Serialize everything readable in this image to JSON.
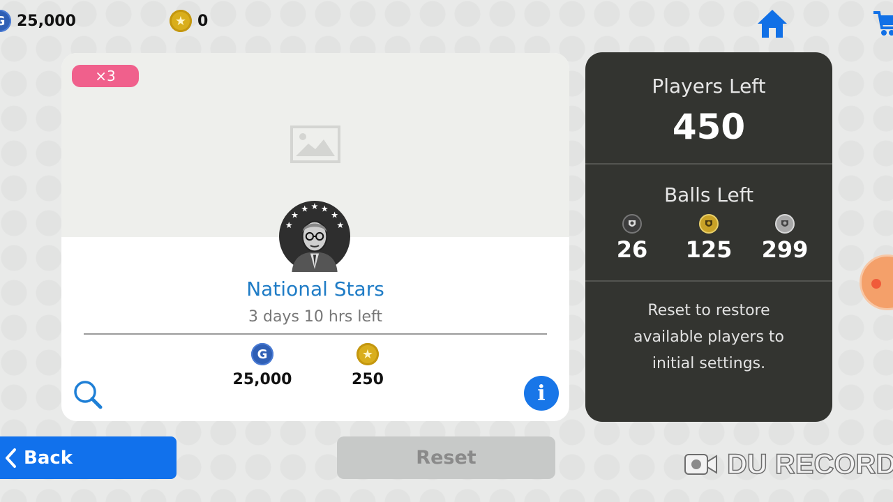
{
  "topbar": {
    "gp_icon_glyph": "G",
    "gp_amount": "25,000",
    "coin_icon": "star-coin-icon",
    "coin_amount": "0",
    "home_icon": "home-icon",
    "cart_icon": "cart-icon"
  },
  "pack": {
    "badge": "×3",
    "title": "National Stars",
    "time_left": "3 days 10 hrs left",
    "prices": [
      {
        "currency": "GP",
        "icon_glyph": "G",
        "amount": "25,000"
      },
      {
        "currency": "coins",
        "icon_glyph": "★",
        "amount": "250"
      }
    ],
    "info_glyph": "i"
  },
  "panel": {
    "players_left_label": "Players Left",
    "players_left_value": "450",
    "balls_left_label": "Balls Left",
    "balls": [
      {
        "type": "black",
        "count": "26",
        "color": "#3c3c3c"
      },
      {
        "type": "gold",
        "count": "125",
        "color": "#c9a227"
      },
      {
        "type": "silver",
        "count": "299",
        "color": "#a8a8a8"
      }
    ],
    "reset_note": "Reset to restore available players to initial settings."
  },
  "buttons": {
    "back_label": "Back",
    "reset_label": "Reset"
  },
  "watermark": {
    "text": "DU RECORDE"
  },
  "colors": {
    "accent_blue": "#1171ec",
    "title_blue": "#1f7cc6",
    "badge_pink": "#f0608c",
    "panel_dark": "#333430",
    "disabled_gray": "#c7c9c8"
  }
}
